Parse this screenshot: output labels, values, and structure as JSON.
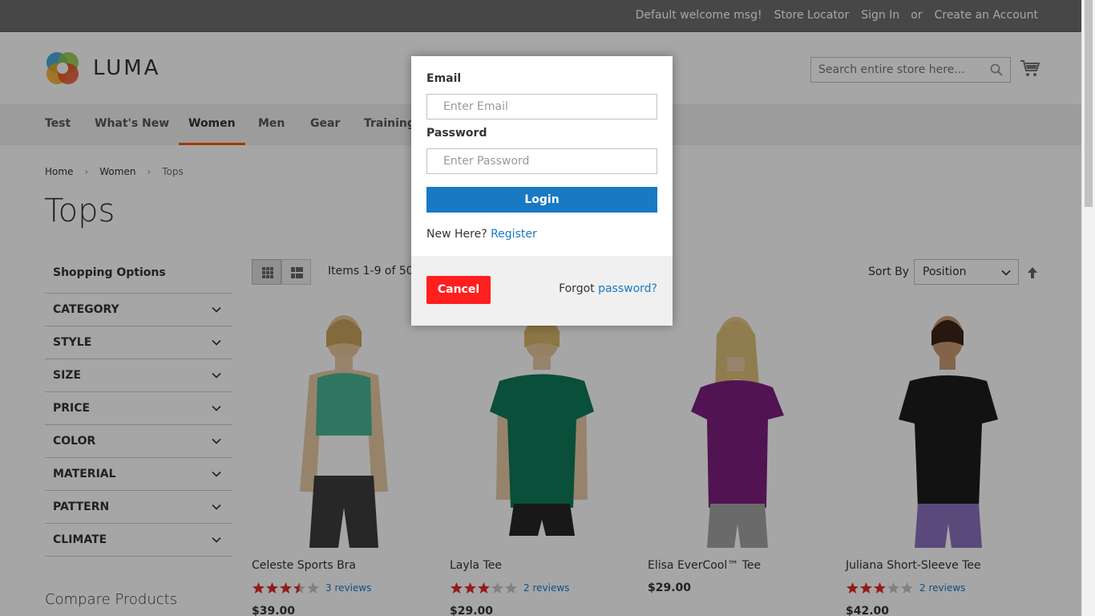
{
  "topbar": {
    "welcome": "Default welcome msg!",
    "store_locator": "Store Locator",
    "sign_in": "Sign In",
    "or": "or",
    "create_account": "Create an Account"
  },
  "header": {
    "logo_text": "LUMA",
    "search_placeholder": "Search entire store here..."
  },
  "nav": {
    "items": [
      {
        "label": "Test"
      },
      {
        "label": "What's New"
      },
      {
        "label": "Women"
      },
      {
        "label": "Men"
      },
      {
        "label": "Gear"
      },
      {
        "label": "Training"
      }
    ],
    "active": "Women"
  },
  "breadcrumb": {
    "items": [
      "Home",
      "Women",
      "Tops"
    ]
  },
  "page_title": "Tops",
  "sidebar": {
    "title": "Shopping Options",
    "filters": [
      "CATEGORY",
      "STYLE",
      "SIZE",
      "PRICE",
      "COLOR",
      "MATERIAL",
      "PATTERN",
      "CLIMATE"
    ],
    "compare_title": "Compare Products"
  },
  "toolbar": {
    "amount": "Items 1-9 of 50",
    "sort_label": "Sort By",
    "sort_value": "Position"
  },
  "products": [
    {
      "name": "Celeste Sports Bra",
      "rating": 3.5,
      "reviews": "3 reviews",
      "price": "$39.00",
      "shirt_color": "#49b596",
      "short_color": "#3c3c3c"
    },
    {
      "name": "Layla Tee",
      "rating": 3,
      "reviews": "2 reviews",
      "price": "$29.00",
      "shirt_color": "#0e7a5a",
      "short_color": "#262626"
    },
    {
      "name": "Elisa EverCool™ Tee",
      "rating": 0,
      "reviews": "",
      "price": "$29.00",
      "shirt_color": "#7d1e7e",
      "short_color": "#a4a4a4"
    },
    {
      "name": "Juliana Short-Sleeve Tee",
      "rating": 3,
      "reviews": "2 reviews",
      "price": "$42.00",
      "shirt_color": "#1c1c1c",
      "short_color": "#8a72bf"
    }
  ],
  "modal": {
    "email_label": "Email",
    "email_placeholder": "Enter Email",
    "password_label": "Password",
    "password_placeholder": "Enter Password",
    "login_label": "Login",
    "new_here": "New Here?",
    "register": "Register",
    "cancel_label": "Cancel",
    "forgot_prefix": "Forgot",
    "forgot_link": "password?"
  },
  "colors": {
    "accent": "#1979c3",
    "cancel": "#ff1f1f",
    "nav_active_underline": "#ff5501",
    "star": "#e02b27"
  }
}
